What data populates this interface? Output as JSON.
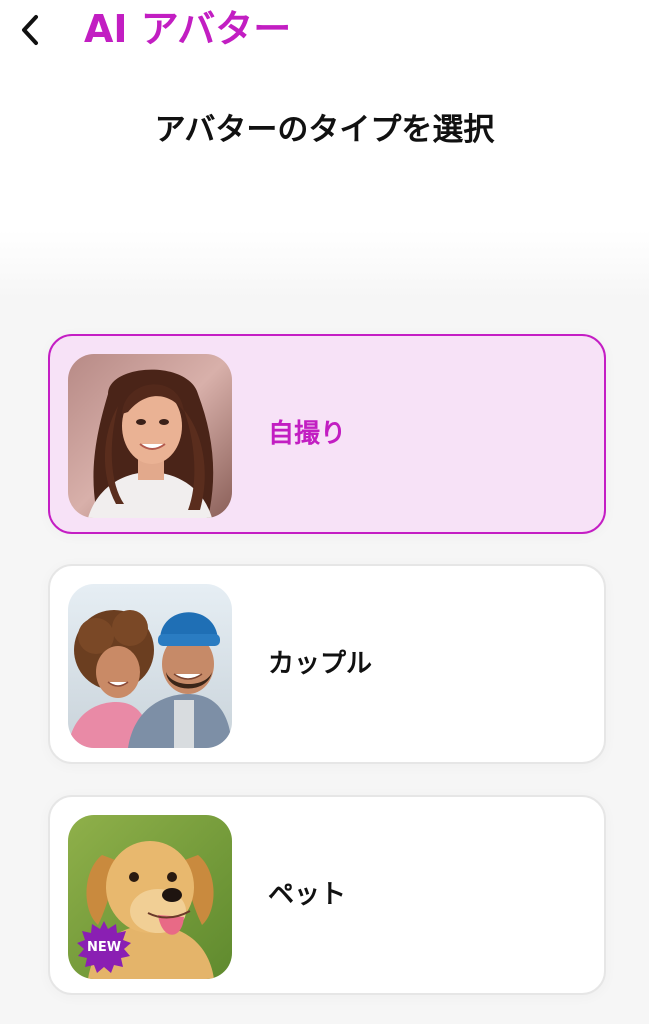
{
  "header": {
    "title": "AI アバター",
    "back_icon": "chevron-left-icon",
    "accent_color": "#c21ec2"
  },
  "subtitle": "アバターのタイプを選択",
  "options": [
    {
      "label": "自撮り",
      "image": "selfie-portrait-photo",
      "selected": true
    },
    {
      "label": "カップル",
      "image": "couple-photo",
      "selected": false
    },
    {
      "label": "ペット",
      "image": "golden-retriever-photo",
      "selected": false,
      "badge": "NEW"
    }
  ]
}
